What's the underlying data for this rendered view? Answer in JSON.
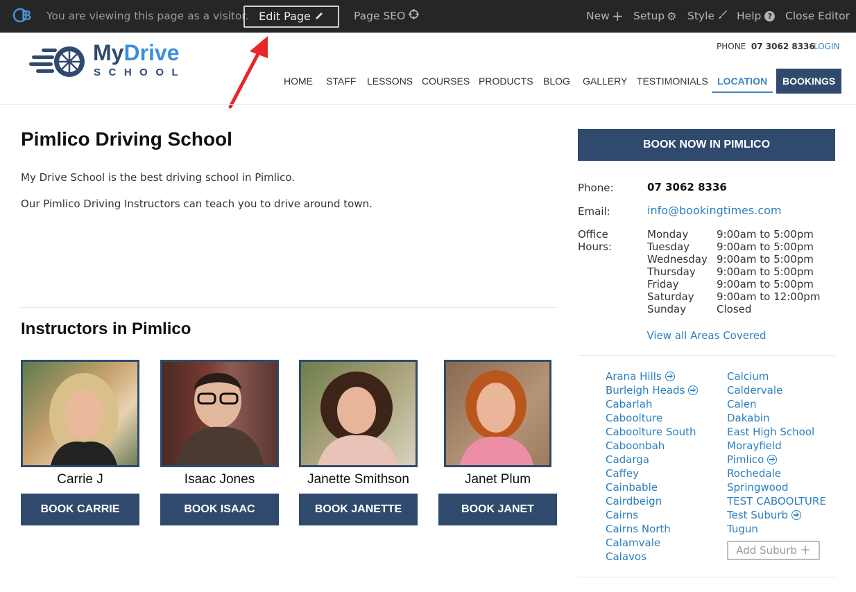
{
  "editor_bar": {
    "visitor_text": "You are viewing this page as a visitor.",
    "edit_page": "Edit Page",
    "page_seo": "Page SEO",
    "new": "New",
    "setup": "Setup",
    "style": "Style",
    "help": "Help",
    "close_editor": "Close Editor"
  },
  "header": {
    "logo_main_a": "My",
    "logo_main_b": "Drive",
    "logo_sub": "SCHOOL",
    "phone_label": "PHONE",
    "phone_number": "07 3062 8336",
    "login": "LOGIN",
    "nav": [
      "HOME",
      "STAFF",
      "LESSONS",
      "COURSES",
      "PRODUCTS",
      "BLOG",
      "GALLERY",
      "TESTIMONIALS",
      "LOCATION",
      "BOOKINGS"
    ]
  },
  "main": {
    "title": "Pimlico Driving School",
    "p1": "My Drive School is the best driving school in Pimlico.",
    "p2": "Our Pimlico Driving Instructors can teach you to drive around town.",
    "instructors_heading": "Instructors in Pimlico",
    "instructors": [
      {
        "name": "Carrie J",
        "button": "BOOK CARRIE"
      },
      {
        "name": "Isaac Jones",
        "button": "BOOK ISAAC"
      },
      {
        "name": "Janette Smithson",
        "button": "BOOK JANETTE"
      },
      {
        "name": "Janet Plum",
        "button": "BOOK JANET"
      }
    ]
  },
  "sidebar": {
    "book_now": "BOOK NOW IN PIMLICO",
    "phone_label": "Phone:",
    "phone": "07 3062 8336",
    "email_label": "Email:",
    "email": "info@bookingtimes.com",
    "hours_label_a": "Office",
    "hours_label_b": "Hours:",
    "hours": [
      {
        "day": "Monday",
        "time": "9:00am to 5:00pm"
      },
      {
        "day": "Tuesday",
        "time": "9:00am to 5:00pm"
      },
      {
        "day": "Wednesday",
        "time": "9:00am to 5:00pm"
      },
      {
        "day": "Thursday",
        "time": "9:00am to 5:00pm"
      },
      {
        "day": "Friday",
        "time": "9:00am to 5:00pm"
      },
      {
        "day": "Saturday",
        "time": "9:00am to 12:00pm"
      },
      {
        "day": "Sunday",
        "time": "Closed"
      }
    ],
    "view_all": "View all Areas Covered",
    "suburbs_col1": [
      "Arana Hills",
      "Burleigh Heads",
      "Cabarlah",
      "Caboolture",
      "Caboolture South",
      "Caboonbah",
      "Cadarga",
      "Caffey",
      "Cainbable",
      "Cairdbeign",
      "Cairns",
      "Cairns North",
      "Calamvale",
      "Calavos"
    ],
    "suburbs_col2": [
      "Calcium",
      "Caldervale",
      "Calen",
      "Dakabin",
      "East High School",
      "Morayfield",
      "Pimlico",
      "Rochedale",
      "Springwood",
      "TEST CABOOLTURE",
      "Test Suburb",
      "Tugun"
    ],
    "add_suburb": "Add Suburb"
  },
  "colors": {
    "navy": "#2f4a6d",
    "link": "#2b7fbf",
    "logo_blue": "#2e6fb6",
    "bar": "#262626"
  }
}
